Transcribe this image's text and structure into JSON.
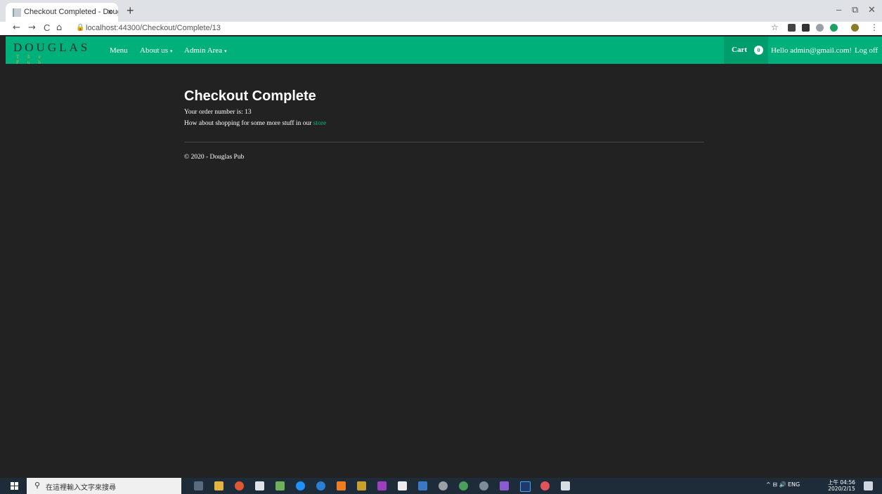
{
  "browser": {
    "tab_title": "Checkout Completed - Dougla",
    "tab_close": "×",
    "new_tab": "+",
    "win_min": "–",
    "win_restore": "⧉",
    "win_close": "✕",
    "back": "←",
    "forward": "→",
    "reload": "C",
    "home": "⌂",
    "lock": "🔒",
    "url": "localhost:44300/Checkout/Complete/13",
    "star": "☆",
    "menu": "⋮"
  },
  "navbar": {
    "brand_top": "DOUGLAS",
    "brand_sub": "The Pub",
    "menu": "Menu",
    "about": "About us",
    "admin": "Admin Area",
    "caret": "▾",
    "cart_label": "Cart",
    "cart_count": "0",
    "greeting": "Hello admin@gmail.com!",
    "logoff": "Log off",
    "color": "#00b07a"
  },
  "main": {
    "title": "Checkout Complete",
    "order_prefix": "Your order number is: ",
    "order_number": "13",
    "shop_prefix": "How about shopping for some more stuff in our ",
    "store_link": "store",
    "footer": "© 2020 - Douglas Pub"
  },
  "taskbar": {
    "search_placeholder": "在這裡輸入文字來搜尋",
    "search_icon": "⚲",
    "tray_text": "^  ⊟ 🔊  ENG",
    "time": "上午 04:56",
    "date": "2020/2/15"
  }
}
